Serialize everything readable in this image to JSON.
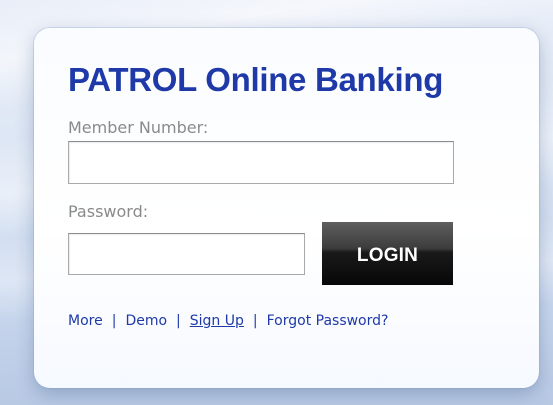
{
  "page": {
    "title": "PATROL Online Banking"
  },
  "form": {
    "member_label": "Member Number:",
    "member_value": "",
    "password_label": "Password:",
    "password_value": "",
    "login_label": "LOGIN"
  },
  "links": {
    "more": "More",
    "demo": "Demo",
    "signup": "Sign Up",
    "forgot": "Forgot Password?",
    "separator": "|"
  },
  "colors": {
    "brand_blue": "#1f3aa8",
    "label_gray": "#8a8a8a",
    "button_black": "#0a0a0a"
  }
}
